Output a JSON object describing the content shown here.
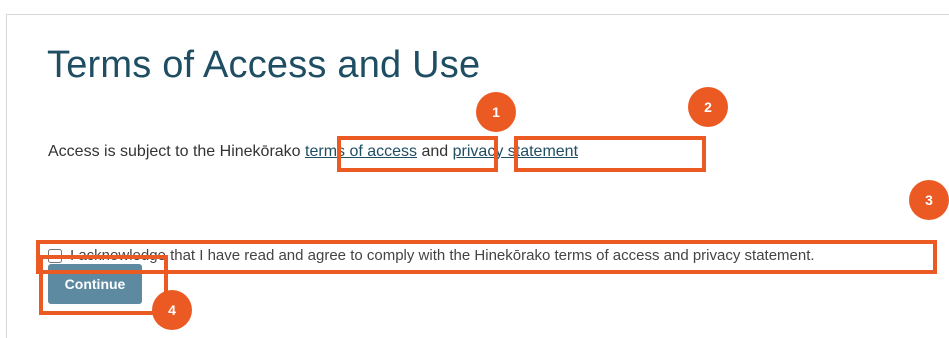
{
  "page": {
    "title": "Terms of Access and Use"
  },
  "access": {
    "prefix": "Access is subject to the Hinekōrako ",
    "terms_link": "terms of access",
    "middle": " and ",
    "privacy_link": "privacy statement"
  },
  "acknowledge": {
    "label": "I acknowledge that I have read and agree to comply with the Hinekōrako terms of access and privacy statement.",
    "checked": false
  },
  "actions": {
    "continue_label": "Continue"
  },
  "annotations": {
    "badges": [
      "1",
      "2",
      "3",
      "4"
    ],
    "color": "#ec5a24"
  }
}
